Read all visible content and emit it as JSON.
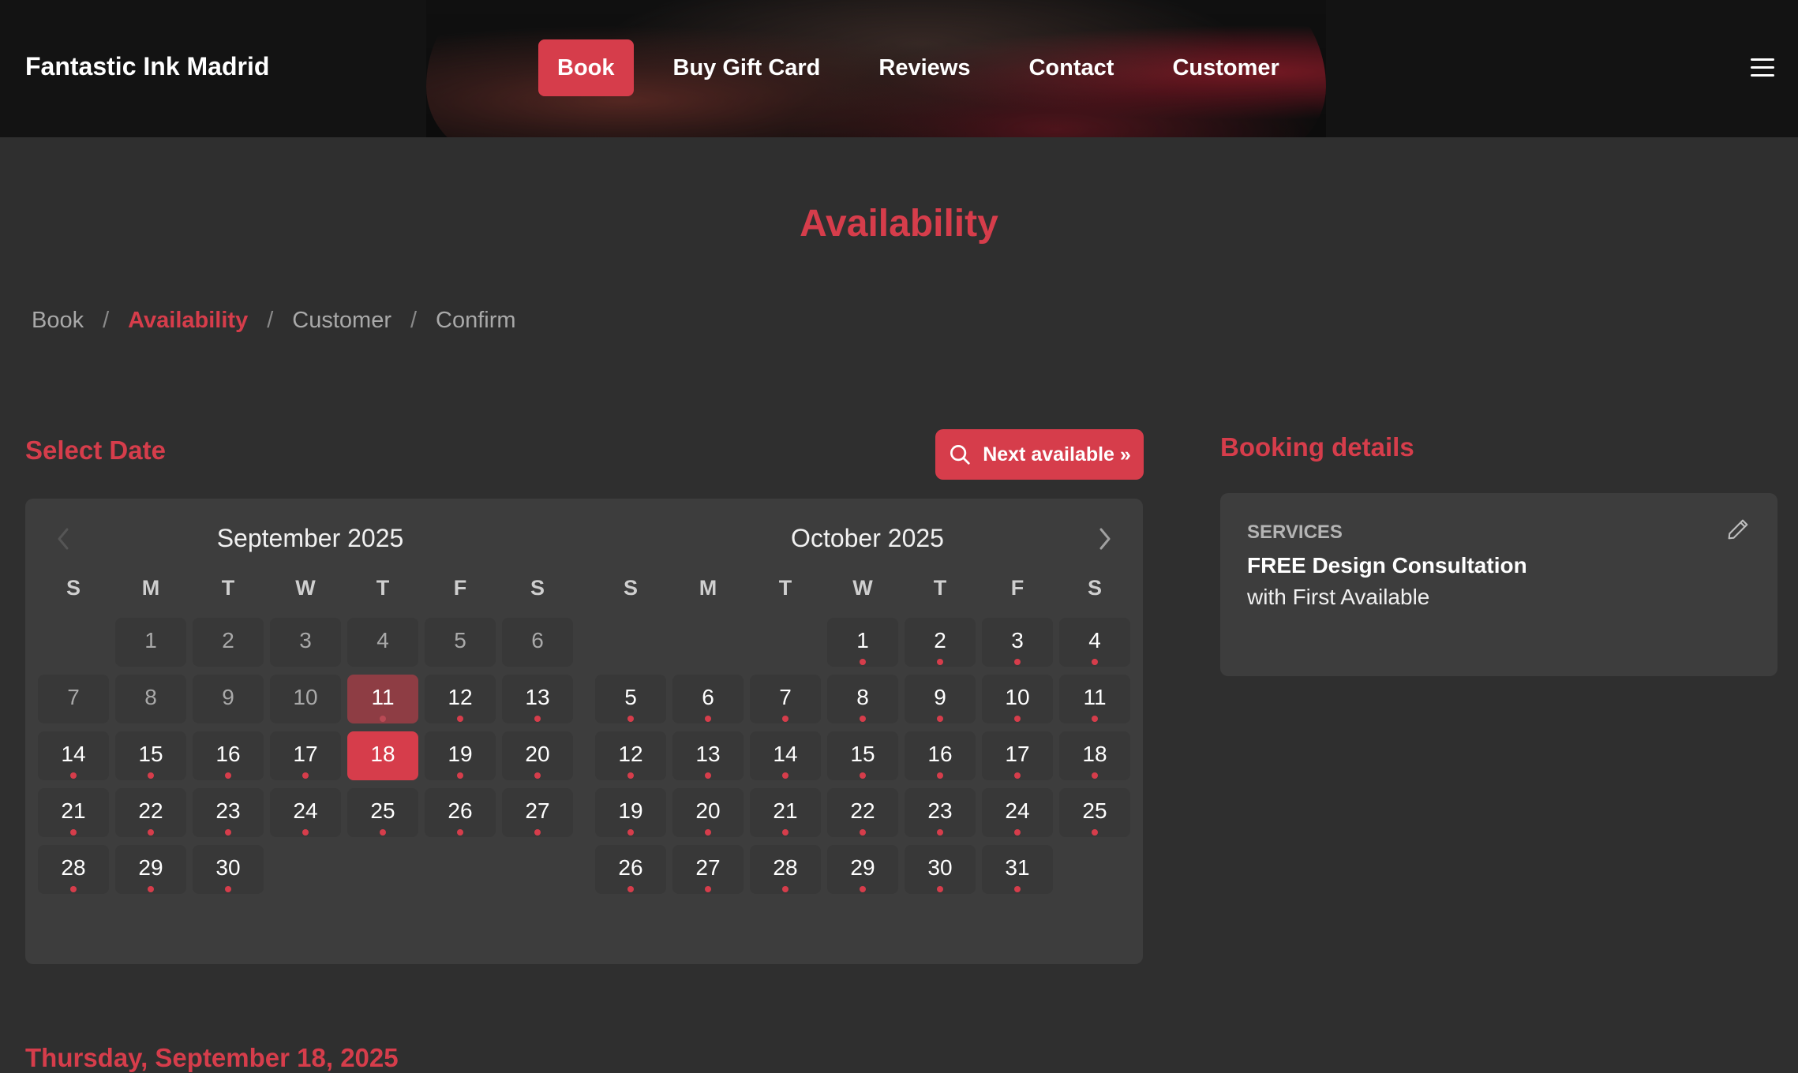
{
  "header": {
    "brand": "Fantastic Ink Madrid",
    "nav": [
      {
        "label": "Book",
        "active": true
      },
      {
        "label": "Buy Gift Card"
      },
      {
        "label": "Reviews"
      },
      {
        "label": "Contact"
      },
      {
        "label": "Customer"
      }
    ],
    "menu_icon": "hamburger-icon"
  },
  "page_title": "Availability",
  "breadcrumb": {
    "items": [
      "Book",
      "Availability",
      "Customer",
      "Confirm"
    ],
    "separator": "/",
    "current": "Availability"
  },
  "select_date": {
    "title": "Select Date",
    "next_available_label": "Next available »",
    "next_available_icon": "search-icon"
  },
  "calendar": {
    "prev_icon": "chevron-left-icon",
    "next_icon": "chevron-right-icon",
    "weekdays": [
      "S",
      "M",
      "T",
      "W",
      "T",
      "F",
      "S"
    ],
    "months": [
      {
        "title": "September 2025",
        "first_weekday": 1,
        "days_in_month": 30,
        "disabled_through": 10,
        "today": 11,
        "selected": 18,
        "available_from": 11
      },
      {
        "title": "October 2025",
        "first_weekday": 3,
        "days_in_month": 31,
        "disabled_through": 0,
        "today": null,
        "selected": null,
        "available_from": 1
      }
    ]
  },
  "booking": {
    "title": "Booking details",
    "services_label": "SERVICES",
    "service_name": "FREE Design Consultation",
    "staff": "with First Available",
    "edit_icon": "pencil-icon"
  },
  "selected_date_heading": "Thursday, September 18, 2025",
  "colors": {
    "accent": "#d63d4b",
    "background": "#2f2f2f",
    "panel": "#3d3d3d",
    "header": "#131313"
  }
}
